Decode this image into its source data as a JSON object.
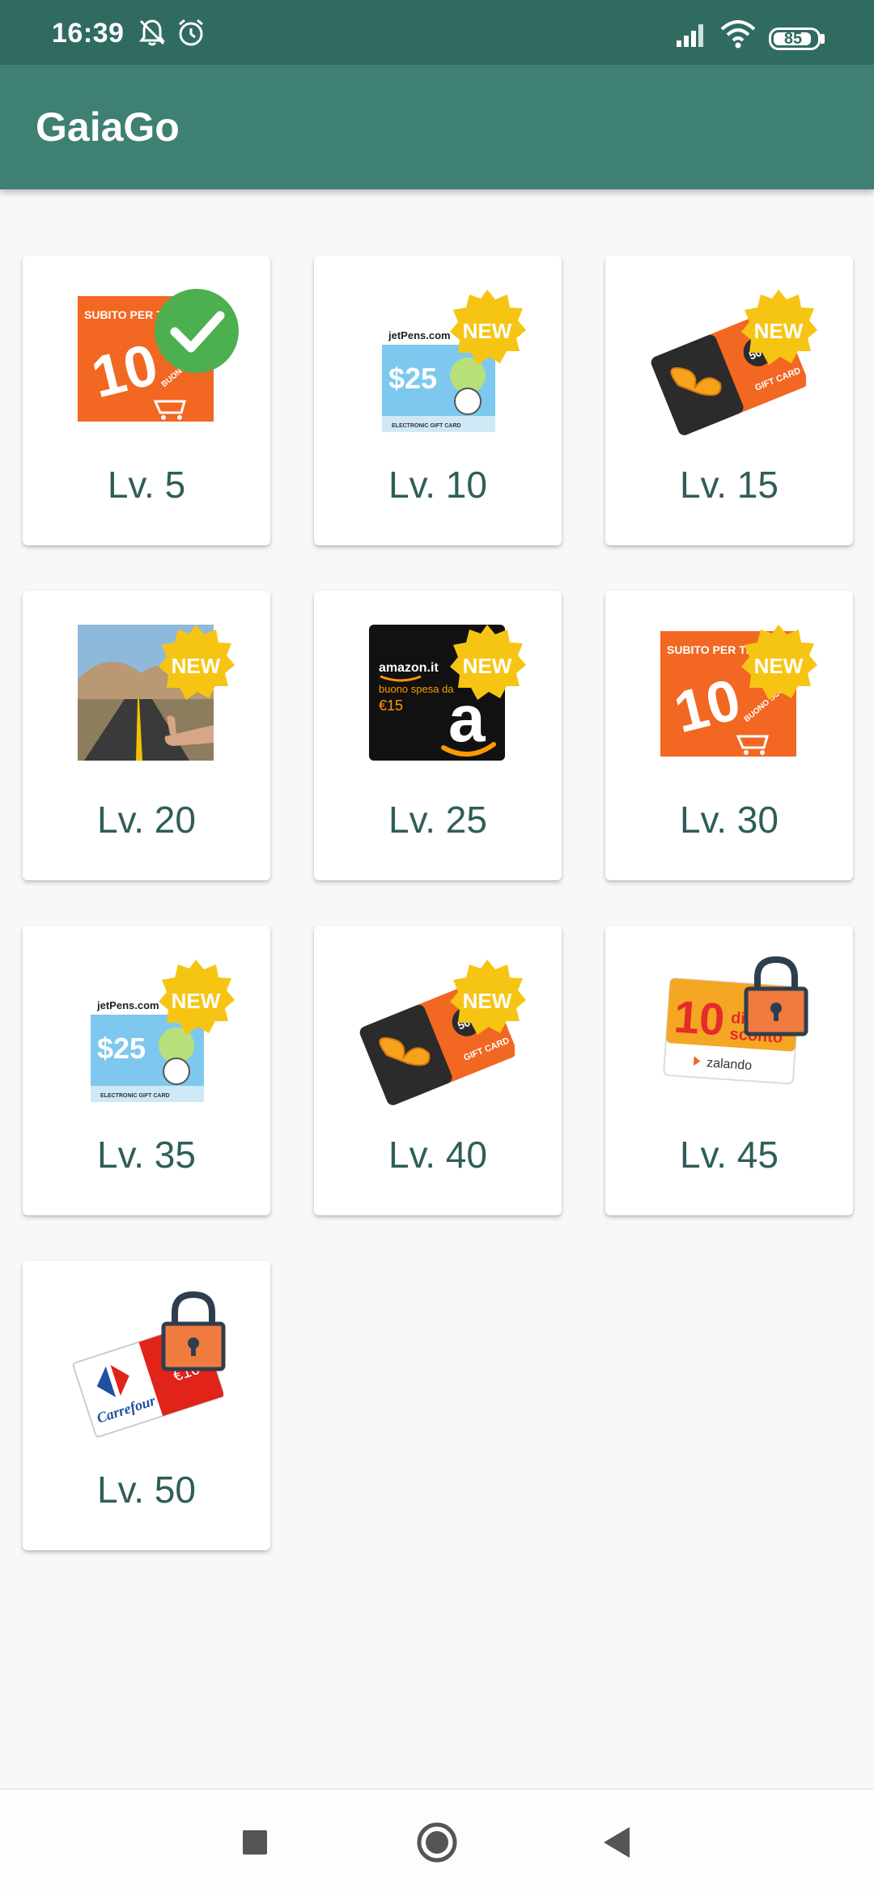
{
  "status_bar": {
    "time": "16:39",
    "icons": [
      "bell-off-icon",
      "alarm-icon",
      "signal-icon",
      "wifi-icon"
    ],
    "battery": "85"
  },
  "app_bar": {
    "title": "GaiaGo"
  },
  "rewards": [
    {
      "level": "Lv. 5",
      "image": "discount-voucher-10",
      "status": "completed"
    },
    {
      "level": "Lv. 10",
      "image": "jetpens-gift-card-25",
      "status": "new"
    },
    {
      "level": "Lv. 15",
      "image": "gift-card-50",
      "status": "new"
    },
    {
      "level": "Lv. 20",
      "image": "road-hitchhiking",
      "status": "new"
    },
    {
      "level": "Lv. 25",
      "image": "amazon-gift-card-15",
      "status": "new"
    },
    {
      "level": "Lv. 30",
      "image": "discount-voucher-10",
      "status": "new"
    },
    {
      "level": "Lv. 35",
      "image": "jetpens-gift-card-25",
      "status": "new"
    },
    {
      "level": "Lv. 40",
      "image": "gift-card-50",
      "status": "new"
    },
    {
      "level": "Lv. 45",
      "image": "zalando-voucher-10",
      "status": "locked"
    },
    {
      "level": "Lv. 50",
      "image": "carrefour-voucher-10",
      "status": "locked"
    }
  ],
  "badge_text": {
    "new": "NEW"
  },
  "image_text": {
    "subito": "SUBITO PER TE",
    "ten": "10",
    "buono_sconto": "BUONO SCONTO",
    "jetpens": "jetPens.com",
    "dollar25": "$25",
    "electronic": "ELECTRONIC GIFT CARD",
    "fifty": "50€",
    "gift_card": "GIFT CARD",
    "amazon": "amazon.it",
    "amazon_sub": "buono spesa da",
    "amazon_val": "€15",
    "amazon_a": "a",
    "zalando_ten": "10",
    "zalando_di": "di",
    "zalando_sconto": "sconto",
    "zalando": "zalando",
    "carrefour": "Carrefour",
    "carrefour_val": "€10"
  },
  "nav_bar": {
    "icons": [
      "recents-icon",
      "home-icon",
      "back-icon"
    ]
  },
  "colors": {
    "status_bar": "#306b61",
    "app_bar": "#3e8073",
    "level_text": "#2f5e58",
    "new_badge": "#f6c514",
    "check_badge": "#4caf50",
    "lock": "#f07b3f"
  }
}
